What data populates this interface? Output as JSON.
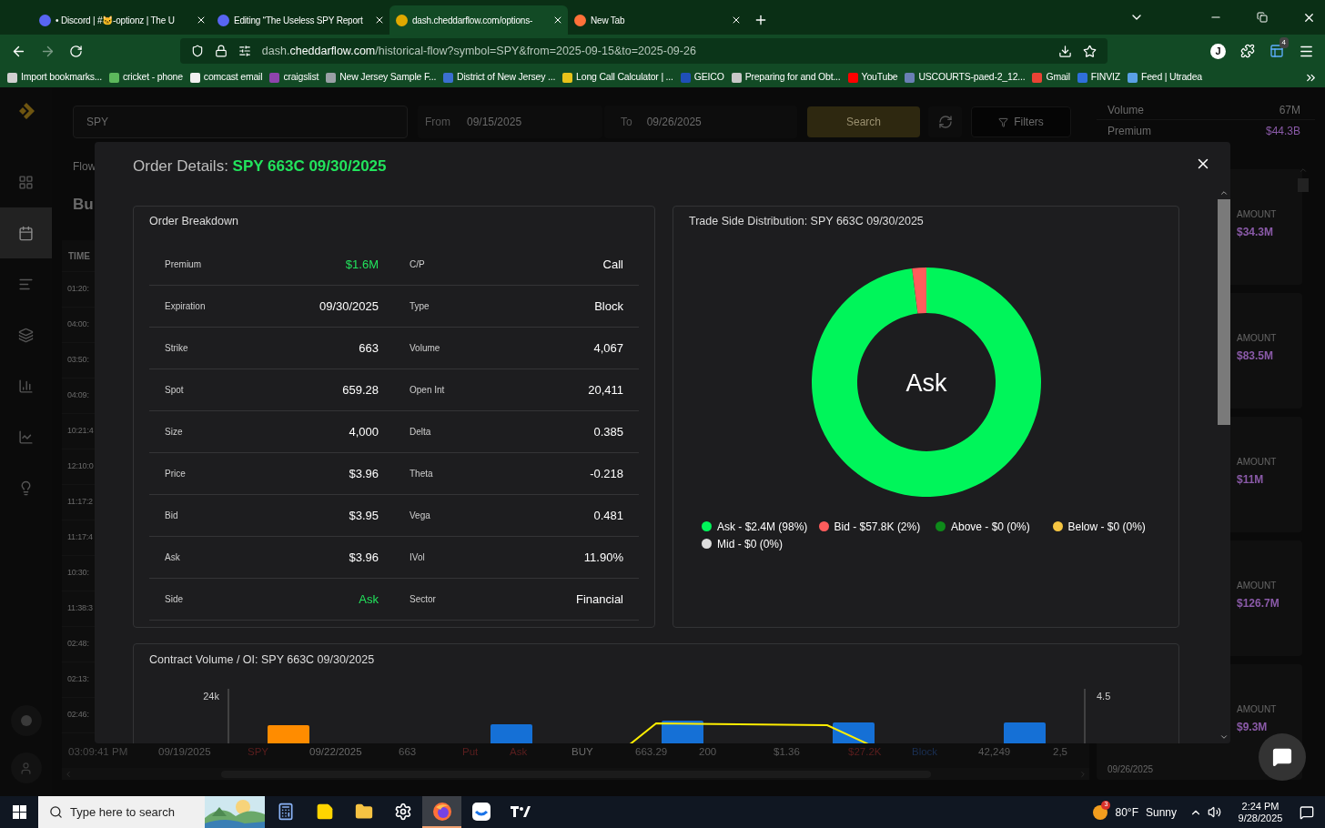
{
  "browser": {
    "tabs": [
      {
        "title": "• Discord | #🐱-optionz | The U",
        "selected": false
      },
      {
        "title": "Editing “The Useless SPY Report",
        "selected": false
      },
      {
        "title": "dash.cheddarflow.com/options-",
        "selected": true
      },
      {
        "title": "New Tab",
        "selected": false
      }
    ],
    "url": "dash.**cheddarflow.com**/historical-flow?symbol=SPY&from=2025-09-15&to=2025-09-26",
    "account_initial": "J",
    "extension_badge": "4",
    "bookmarks": [
      {
        "label": "Import bookmarks...",
        "color": "#d0d0d0"
      },
      {
        "label": "cricket - phone",
        "color": "#5cb85c"
      },
      {
        "label": "comcast email",
        "color": "#f0f0f0"
      },
      {
        "label": "craigslist",
        "color": "#8e44ad"
      },
      {
        "label": "New Jersey Sample F...",
        "color": "#9aa0a6"
      },
      {
        "label": "District of New Jersey ...",
        "color": "#3b6fd1"
      },
      {
        "label": "Long Call Calculator | ...",
        "color": "#e8c21a"
      },
      {
        "label": "GEICO",
        "color": "#1f4fb8"
      },
      {
        "label": "Preparing for and Obt...",
        "color": "#c8c8c8"
      },
      {
        "label": "YouTube",
        "color": "#ff0000"
      },
      {
        "label": "USCOURTS-paed-2_12...",
        "color": "#6a7fb5"
      },
      {
        "label": "Gmail",
        "color": "#ea4335"
      },
      {
        "label": "FINVIZ",
        "color": "#2f6fdb"
      },
      {
        "label": "Feed | Utradea",
        "color": "#5aa0e6"
      }
    ]
  },
  "sidebar": {
    "items": [
      {
        "kind": "grid",
        "selected": false
      },
      {
        "kind": "calendar",
        "selected": true
      },
      {
        "kind": "list",
        "selected": false
      },
      {
        "kind": "layers",
        "selected": false
      },
      {
        "kind": "bars",
        "selected": false
      },
      {
        "kind": "trend",
        "selected": false
      },
      {
        "kind": "bulb",
        "selected": false
      }
    ]
  },
  "toolbar": {
    "search": {
      "value": "SPY"
    },
    "from": {
      "label": "From",
      "value": "09/15/2025"
    },
    "to": {
      "label": "To",
      "value": "09/26/2025"
    },
    "search_button": "Search",
    "filters_button": "Filters"
  },
  "page": {
    "tab": "Flow",
    "heading": "Bu"
  },
  "table": {
    "header": "TIME",
    "rows": [
      "01:20:",
      "04:00:",
      "03:50:",
      "04:09:",
      "10:21:4",
      "12:10:0",
      "11:17:2",
      "11:17:4",
      "10:30:",
      "11:38:3",
      "02:48:",
      "02:13:",
      "02:46:"
    ],
    "last_row": [
      {
        "text": "03:09:41 PM",
        "color": "#4a4a4a"
      },
      {
        "text": "09/19/2025",
        "color": "#5a5a5a"
      },
      {
        "text": "SPY",
        "color": "#5a1e1e"
      },
      {
        "text": "09/22/2025",
        "color": "#6a6a6a"
      },
      {
        "text": "663",
        "color": "#5a5a5a"
      },
      {
        "text": "Put",
        "color": "#5a1e1e"
      },
      {
        "text": "Ask",
        "color": "#5a1e1e"
      },
      {
        "text": "BUY",
        "color": "#6a6a6a"
      },
      {
        "text": "663.29",
        "color": "#5a5a5a"
      },
      {
        "text": "200",
        "color": "#5a5a5a"
      },
      {
        "text": "$1.36",
        "color": "#5a5a5a"
      },
      {
        "text": "$27.2K",
        "color": "#5a1e1e"
      },
      {
        "text": "Block",
        "color": "#1a2f52"
      },
      {
        "text": "42,249",
        "color": "#5a5a5a"
      },
      {
        "text": "2,5",
        "color": "#5a5a5a"
      }
    ]
  },
  "summary": {
    "stats": [
      {
        "label": "Volume",
        "value": "67M"
      },
      {
        "label": "Premium",
        "value": "$44.3B"
      }
    ],
    "cards": [
      {
        "label": "AMOUNT",
        "value": "$34.3M"
      },
      {
        "label": "AMOUNT",
        "value": "$83.5M"
      },
      {
        "label": "AMOUNT",
        "value": "$11M"
      },
      {
        "label": "AMOUNT",
        "value": "$126.7M"
      },
      {
        "label": "AMOUNT",
        "value": "$9.3M"
      }
    ],
    "card_date": "09/26/2025"
  },
  "modal": {
    "title": "Order Details:",
    "symbol": "SPY 663C 09/30/2025",
    "breakdown": {
      "title": "Order Breakdown",
      "rows": [
        {
          "pairs": [
            {
              "label": "Premium",
              "value": "$1.6M",
              "highlight": true
            },
            {
              "label": "C/P",
              "value": "Call",
              "highlight": false
            }
          ]
        },
        {
          "pairs": [
            {
              "label": "Expiration",
              "value": "09/30/2025",
              "highlight": false
            },
            {
              "label": "Type",
              "value": "Block",
              "highlight": false
            }
          ]
        },
        {
          "pairs": [
            {
              "label": "Strike",
              "value": "663",
              "highlight": false
            },
            {
              "label": "Volume",
              "value": "4,067",
              "highlight": false
            }
          ]
        },
        {
          "pairs": [
            {
              "label": "Spot",
              "value": "659.28",
              "highlight": false
            },
            {
              "label": "Open Int",
              "value": "20,411",
              "highlight": false
            }
          ]
        },
        {
          "pairs": [
            {
              "label": "Size",
              "value": "4,000",
              "highlight": false
            },
            {
              "label": "Delta",
              "value": "0.385",
              "highlight": false
            }
          ]
        },
        {
          "pairs": [
            {
              "label": "Price",
              "value": "$3.96",
              "highlight": false
            },
            {
              "label": "Theta",
              "value": "-0.218",
              "highlight": false
            }
          ]
        },
        {
          "pairs": [
            {
              "label": "Bid",
              "value": "$3.95",
              "highlight": false
            },
            {
              "label": "Vega",
              "value": "0.481",
              "highlight": false
            }
          ]
        },
        {
          "pairs": [
            {
              "label": "Ask",
              "value": "$3.96",
              "highlight": false
            },
            {
              "label": "IVol",
              "value": "11.90%",
              "highlight": false
            }
          ]
        },
        {
          "pairs": [
            {
              "label": "Side",
              "value": "Ask",
              "highlight": true
            },
            {
              "label": "Sector",
              "value": "Financial",
              "highlight": false
            }
          ]
        }
      ]
    },
    "distribution": {
      "title": "Trade Side Distribution: SPY 663C 09/30/2025",
      "center_label": "Ask",
      "chart_data": {
        "type": "donut",
        "values": [
          98,
          2,
          0,
          0,
          0
        ]
      },
      "legend": [
        {
          "text": "Ask - $2.4M (98%)",
          "color": "#00f55a"
        },
        {
          "text": "Bid - $57.8K (2%)",
          "color": "#ff5c5c"
        },
        {
          "text": "Above - $0 (0%)",
          "color": "#0e8a1a"
        },
        {
          "text": "Below - $0 (0%)",
          "color": "#f5c542"
        },
        {
          "text": "Mid - $0 (0%)",
          "color": "#dddddd"
        }
      ]
    },
    "volume_chart": {
      "title": "Contract Volume / OI: SPY 663C 09/30/2025",
      "left_axis_label": "24k",
      "right_axis_label": "4.5"
    }
  },
  "taskbar": {
    "search_placeholder": "Type here to search",
    "apps": [
      {
        "kind": "calculator",
        "selected": false
      },
      {
        "kind": "notes",
        "selected": false
      },
      {
        "kind": "folder",
        "selected": false
      },
      {
        "kind": "settings",
        "selected": false
      },
      {
        "kind": "browser",
        "selected": true
      },
      {
        "kind": "cloud",
        "selected": false
      },
      {
        "kind": "chart",
        "selected": false
      }
    ],
    "weather_badge": "3",
    "temperature": "80°F",
    "weather": "Sunny",
    "time": "2:24 PM",
    "date": "9/28/2025"
  }
}
